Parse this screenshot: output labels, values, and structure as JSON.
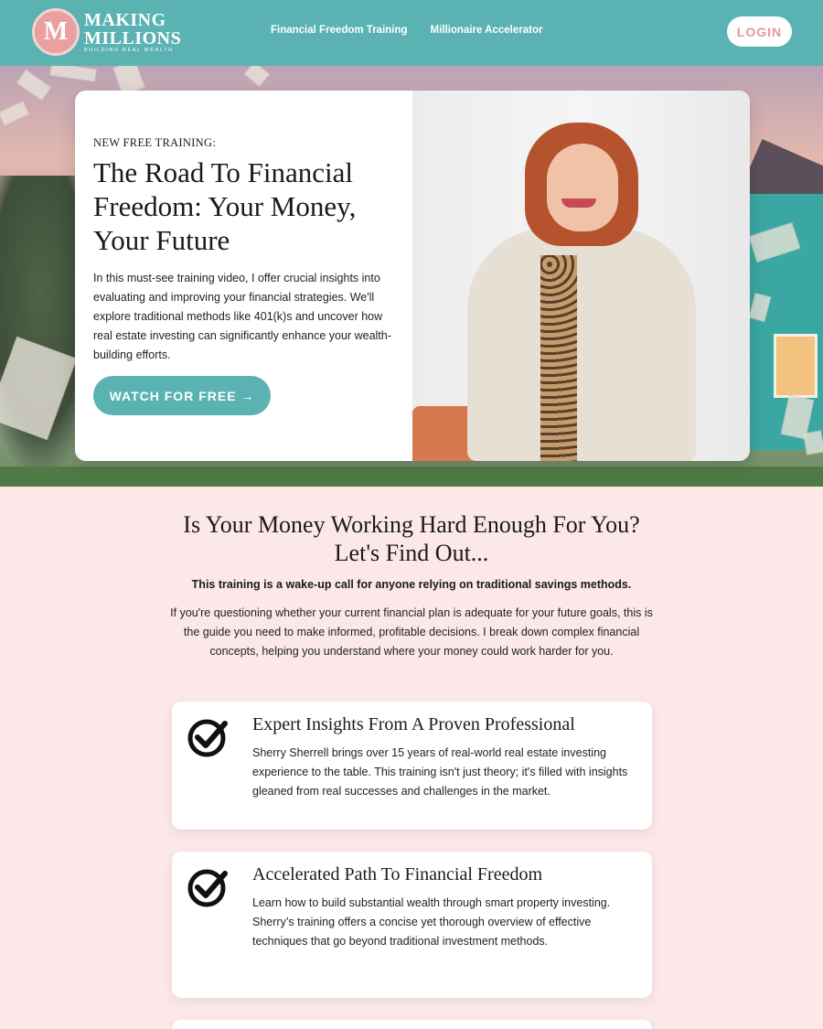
{
  "header": {
    "logo_monogram": "M",
    "logo_line1": "MAKING",
    "logo_line2": "MILLIONS",
    "logo_tagline": "BUILDING REAL WEALTH",
    "nav": [
      "Financial Freedom Training",
      "Millionaire Accelerator"
    ],
    "login_label": "LOGIN"
  },
  "hero": {
    "eyebrow": "NEW FREE TRAINING:",
    "title": "The Road To Financial Freedom: Your Money, Your Future",
    "description": "In this must-see training video, I offer crucial insights into evaluating and improving your financial strategies. We'll explore traditional methods like 401(k)s and uncover how real estate investing can significantly enhance your wealth-building efforts.",
    "cta_label": "WATCH FOR FREE →"
  },
  "section": {
    "title": "Is Your Money Working Hard Enough For You? Let's Find Out...",
    "bold_line": "This training is a wake-up call for anyone relying on traditional savings methods.",
    "body": "If you're questioning whether your current financial plan is adequate for your future goals, this is the guide you need to make informed, profitable decisions. I break down complex financial concepts, helping you understand where your money could work harder for you."
  },
  "features": [
    {
      "icon": "check-circle-icon",
      "title": "Expert Insights From A Proven Professional",
      "description": "Sherry Sherrell brings over 15 years of real-world real estate investing experience to the table. This training isn't just theory; it's filled with insights gleaned from real successes and challenges in the market."
    },
    {
      "icon": "check-circle-icon",
      "title": "Accelerated Path To Financial Freedom",
      "description": "Learn how to build substantial wealth through smart property investing. Sherry’s training offers a concise yet thorough overview of effective techniques that go beyond traditional investment methods."
    }
  ],
  "colors": {
    "teal": "#5ab3b2",
    "pink_bg": "#fce8e8",
    "login_text": "#e89896"
  }
}
